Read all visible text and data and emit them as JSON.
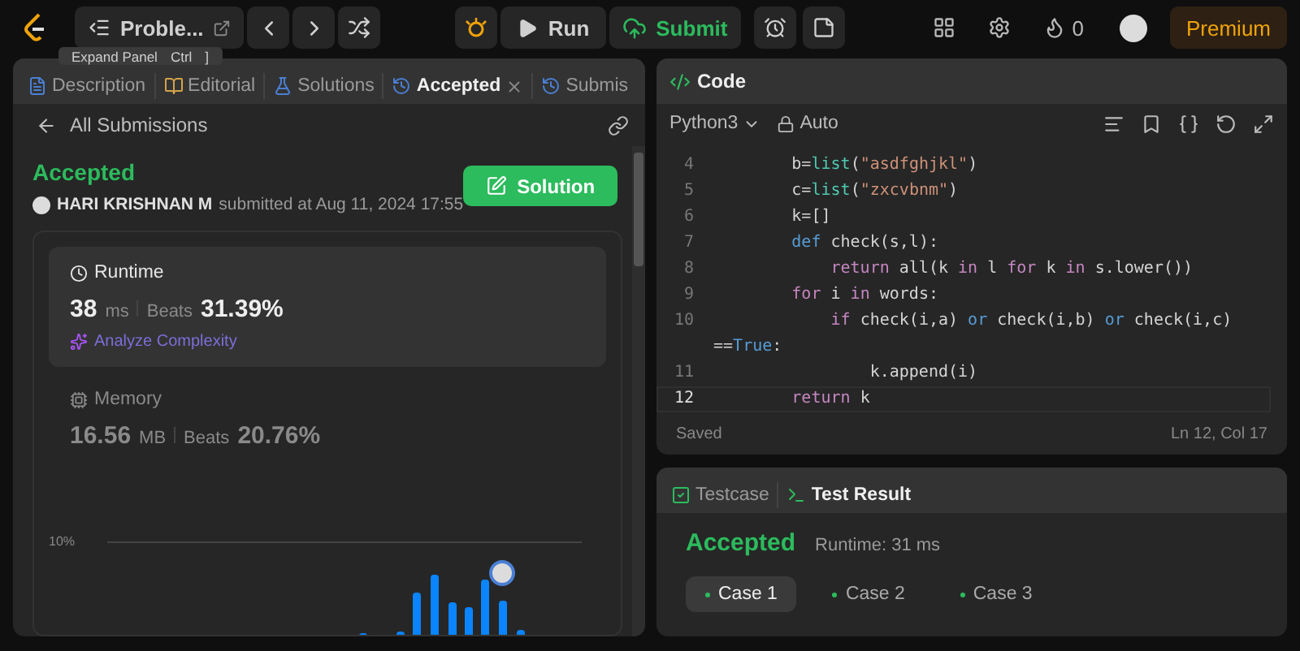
{
  "header": {
    "problem_title": "Proble...",
    "run": "Run",
    "submit": "Submit",
    "flame_count": "0",
    "premium": "Premium"
  },
  "tooltip": {
    "label": "Expand Panel",
    "keys": [
      "Ctrl",
      "]"
    ]
  },
  "left_tabs": [
    {
      "label": "Description",
      "selected": false,
      "closable": false
    },
    {
      "label": "Editorial",
      "selected": false,
      "closable": false
    },
    {
      "label": "Solutions",
      "selected": false,
      "closable": false
    },
    {
      "label": "Accepted",
      "selected": true,
      "closable": true
    },
    {
      "label": "Submis",
      "selected": false,
      "closable": false
    }
  ],
  "submission": {
    "back": "All Submissions",
    "status": "Accepted",
    "user": "HARI KRISHNAN M",
    "submitted": "submitted at Aug 11, 2024 17:55",
    "solution_button": "Solution"
  },
  "stats": [
    {
      "kind": "runtime",
      "title": "Runtime",
      "value": "38",
      "unit": "ms",
      "beats_label": "Beats",
      "beats": "31.39%",
      "link": "Analyze Complexity",
      "selected": true
    },
    {
      "kind": "memory",
      "title": "Memory",
      "value": "16.56",
      "unit": "MB",
      "beats_label": "Beats",
      "beats": "20.76%",
      "selected": false
    }
  ],
  "distribution": {
    "tick_label": "10%"
  },
  "code": {
    "title": "Code",
    "language": "Python3",
    "mode": "Auto",
    "lines": [
      {
        "number": "4",
        "selected": false,
        "tokens": [
          {
            "kind": "plain",
            "text": "        b="
          },
          {
            "kind": "builtin",
            "text": "list"
          },
          {
            "kind": "plain",
            "text": "("
          },
          {
            "kind": "string",
            "text": "\"asdfghjkl\""
          },
          {
            "kind": "plain",
            "text": ")"
          }
        ]
      },
      {
        "number": "5",
        "selected": false,
        "tokens": [
          {
            "kind": "plain",
            "text": "        c="
          },
          {
            "kind": "builtin",
            "text": "list"
          },
          {
            "kind": "plain",
            "text": "("
          },
          {
            "kind": "string",
            "text": "\"zxcvbnm\""
          },
          {
            "kind": "plain",
            "text": ")"
          }
        ]
      },
      {
        "number": "6",
        "selected": false,
        "tokens": [
          {
            "kind": "plain",
            "text": "        k=[]"
          }
        ]
      },
      {
        "number": "7",
        "selected": false,
        "tokens": [
          {
            "kind": "def",
            "text": "        def"
          },
          {
            "kind": "plain",
            "text": " check(s,l):"
          }
        ]
      },
      {
        "number": "8",
        "selected": false,
        "tokens": [
          {
            "kind": "keyword",
            "text": "            return"
          },
          {
            "kind": "plain",
            "text": " all(k "
          },
          {
            "kind": "keyword",
            "text": "in"
          },
          {
            "kind": "plain",
            "text": " l "
          },
          {
            "kind": "keyword",
            "text": "for"
          },
          {
            "kind": "plain",
            "text": " k "
          },
          {
            "kind": "keyword",
            "text": "in"
          },
          {
            "kind": "plain",
            "text": " s.lower())"
          }
        ]
      },
      {
        "number": "9",
        "selected": false,
        "tokens": [
          {
            "kind": "keyword",
            "text": "        for"
          },
          {
            "kind": "plain",
            "text": " i "
          },
          {
            "kind": "keyword",
            "text": "in"
          },
          {
            "kind": "plain",
            "text": " words:"
          }
        ]
      },
      {
        "number": "10",
        "selected": false,
        "tokens": [
          {
            "kind": "keyword",
            "text": "            if"
          },
          {
            "kind": "plain",
            "text": " check(i,a) "
          },
          {
            "kind": "def",
            "text": "or"
          },
          {
            "kind": "plain",
            "text": " check(i,b) "
          },
          {
            "kind": "def",
            "text": "or"
          },
          {
            "kind": "plain",
            "text": " check(i,c)"
          }
        ]
      },
      {
        "tokens": [
          {
            "kind": "plain",
            "text": "=="
          },
          {
            "kind": "def",
            "text": "True"
          },
          {
            "kind": "plain",
            "text": ":"
          }
        ]
      },
      {
        "number": "11",
        "selected": false,
        "tokens": [
          {
            "kind": "plain",
            "text": "                k.append(i)"
          }
        ]
      },
      {
        "number": "12",
        "selected": true,
        "tokens": [
          {
            "kind": "keyword",
            "text": "        return"
          },
          {
            "kind": "plain",
            "text": " k"
          }
        ]
      }
    ],
    "status": "Saved",
    "position": "Ln 12, Col 17"
  },
  "test_tabs": [
    {
      "label": "Testcase",
      "selected": false
    },
    {
      "label": "Test Result",
      "selected": true
    }
  ],
  "result": {
    "status": "Accepted",
    "runtime": "Runtime: 31 ms",
    "cases": [
      {
        "label": "Case 1",
        "selected": true
      },
      {
        "label": "Case 2",
        "selected": false
      },
      {
        "label": "Case 3",
        "selected": false
      }
    ]
  }
}
